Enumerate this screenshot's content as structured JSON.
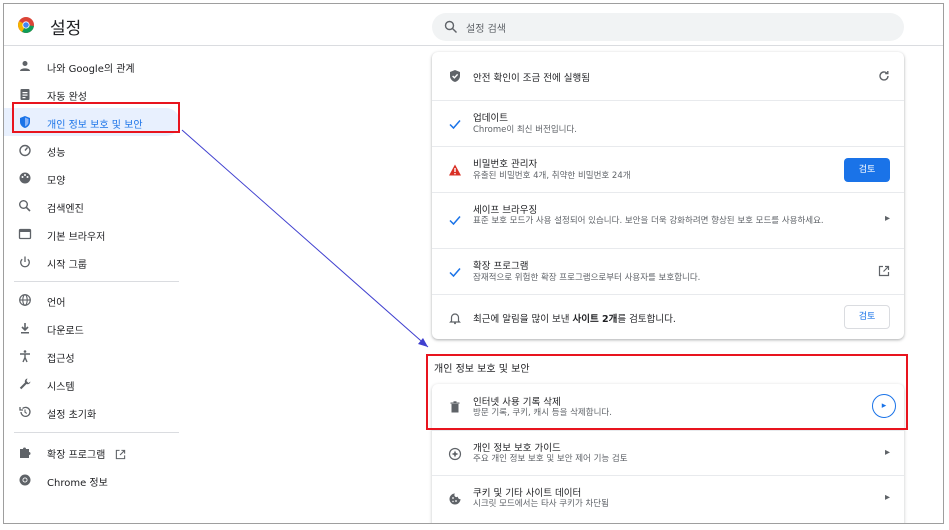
{
  "header": {
    "title": "설정",
    "search_placeholder": "설정 검색"
  },
  "sidebar": {
    "items": [
      {
        "label": "나와 Google의 관계",
        "icon": "person-icon"
      },
      {
        "label": "자동 완성",
        "icon": "clipboard-icon"
      },
      {
        "label": "개인 정보 보호 및 보안",
        "icon": "shield-icon"
      },
      {
        "label": "성능",
        "icon": "speedometer-icon"
      },
      {
        "label": "모양",
        "icon": "palette-icon"
      },
      {
        "label": "검색엔진",
        "icon": "search-icon"
      },
      {
        "label": "기본 브라우저",
        "icon": "browser-icon"
      },
      {
        "label": "시작 그룹",
        "icon": "power-icon"
      },
      {
        "label": "언어",
        "icon": "globe-icon"
      },
      {
        "label": "다운로드",
        "icon": "download-icon"
      },
      {
        "label": "접근성",
        "icon": "accessibility-icon"
      },
      {
        "label": "시스템",
        "icon": "wrench-icon"
      },
      {
        "label": "설정 초기화",
        "icon": "reset-icon"
      },
      {
        "label": "확장 프로그램",
        "icon": "puzzle-icon"
      },
      {
        "label": "Chrome 정보",
        "icon": "chrome-icon"
      }
    ]
  },
  "safety_check": {
    "header": "안전 확인이 조금 전에 실행됨",
    "update_title": "업데이트",
    "update_desc": "Chrome이 최신 버전입니다.",
    "password_title": "비밀번호 관리자",
    "password_desc": "유출된 비밀번호 4개, 취약한 비밀번호 24개",
    "password_button": "검토",
    "safe_browsing_title": "세이프 브라우징",
    "safe_browsing_desc": "표준 보호 모드가 사용 설정되어 있습니다. 보안을 더욱 강화하려면 향상된 보호 모드를 사용하세요.",
    "extensions_title": "확장 프로그램",
    "extensions_desc": "잠재적으로 위험한 확장 프로그램으로부터 사용자를 보호합니다.",
    "notifications_pre": "최근에 알림을 많이 보낸",
    "notifications_bold": "사이트 2개",
    "notifications_post": "를 검토합니다.",
    "notifications_button": "검토"
  },
  "privacy_section": {
    "title": "개인 정보 보호 및 보안",
    "items": [
      {
        "title": "인터넷 사용 기록 삭제",
        "desc": "방문 기록, 쿠키, 캐시 등을 삭제합니다."
      },
      {
        "title": "개인 정보 보호 가이드",
        "desc": "주요 개인 정보 보호 및 보안 제어 기능 검토"
      },
      {
        "title": "쿠키 및 기타 사이트 데이터",
        "desc": "시크릿 모드에서는 타사 쿠키가 차단됨"
      }
    ]
  },
  "colors": {
    "accent": "#1a73e8",
    "annotation": "#e8141e",
    "warning": "#d93025"
  }
}
